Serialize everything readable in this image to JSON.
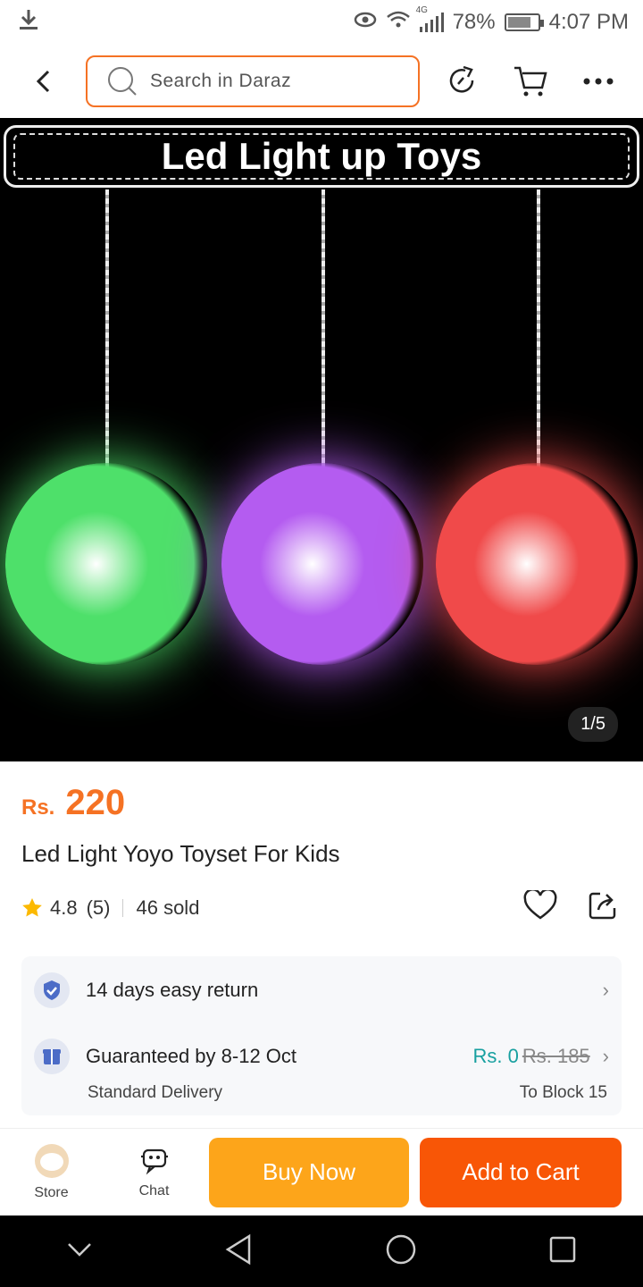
{
  "status_bar": {
    "network": "4G",
    "battery": "78%",
    "battery_level": 0.78,
    "time": "4:07 PM",
    "icons": [
      "download-icon",
      "eye-icon",
      "wifi-icon",
      "signal-icon",
      "battery-icon"
    ]
  },
  "header": {
    "search_placeholder": "Search in Daraz",
    "icons": [
      "back-arrow-icon",
      "search-icon",
      "share-refresh-icon",
      "cart-icon",
      "more-icon"
    ]
  },
  "gallery": {
    "banner_text": "Led Light up Toys",
    "counter": "1/5",
    "yoyo_colors": [
      "#4ee06a",
      "#b45cf0",
      "#f04a4a"
    ]
  },
  "product": {
    "currency": "Rs.",
    "price": "220",
    "title": "Led Light Yoyo Toyset For Kids",
    "rating": "4.8",
    "rating_count": "(5)",
    "sold": "46 sold"
  },
  "services": {
    "return_text": "14 days easy return",
    "delivery_text": "Guaranteed by 8-12 Oct",
    "delivery_fee": "Rs. 0",
    "delivery_fee_original": "Rs. 185",
    "delivery_type": "Standard Delivery",
    "delivery_location": "To Block 15"
  },
  "bottom_bar": {
    "store_label": "Store",
    "chat_label": "Chat",
    "buy_now": "Buy Now",
    "add_to_cart": "Add to Cart"
  },
  "colors": {
    "accent": "#f57224",
    "buy_now": "#fda51a",
    "add_to_cart": "#f85606",
    "free_delivery": "#18a0a0"
  }
}
